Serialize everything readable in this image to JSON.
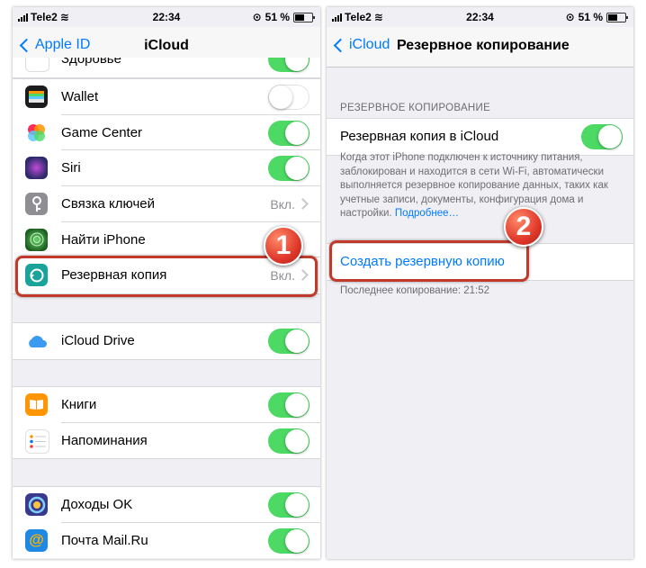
{
  "left": {
    "status": {
      "carrier": "Tele2",
      "time": "22:34",
      "battery": "51 %"
    },
    "nav": {
      "back": "Apple ID",
      "title": "iCloud"
    },
    "top_partial": {
      "label": "Здоровье"
    },
    "group1": [
      {
        "label": "Wallet",
        "icon": "wallet-icon",
        "icon_color": "#1c1c1e",
        "toggle": "off"
      },
      {
        "label": "Game Center",
        "icon": "game-center-icon",
        "icon_color": "#ffffff",
        "toggle": "on"
      },
      {
        "label": "Siri",
        "icon": "siri-icon",
        "icon_color": "#1e1e3c",
        "toggle": "on"
      },
      {
        "label": "Связка ключей",
        "icon": "key-icon",
        "icon_color": "#8e8e93",
        "value": "Вкл."
      },
      {
        "label": "Найти iPhone",
        "icon": "find-iphone-icon",
        "icon_color": "#2e7d32"
      },
      {
        "label": "Резервная копия",
        "icon": "backup-icon",
        "icon_color": "#1aa39b",
        "value": "Вкл."
      }
    ],
    "group2": [
      {
        "label": "iCloud Drive",
        "icon": "icloud-icon",
        "icon_color": "#ffffff",
        "toggle": "on"
      }
    ],
    "group3": [
      {
        "label": "Книги",
        "icon": "books-icon",
        "icon_color": "#ff9500",
        "toggle": "on"
      },
      {
        "label": "Напоминания",
        "icon": "reminders-icon",
        "icon_color": "#ffffff",
        "toggle": "on"
      }
    ],
    "group4": [
      {
        "label": "Доходы OK",
        "icon": "dohody-icon",
        "icon_color": "#3a3a8c",
        "toggle": "on"
      },
      {
        "label": "Почта Mail.Ru",
        "icon": "mailru-icon",
        "icon_color": "#1e88e5",
        "toggle": "on"
      }
    ],
    "badge": "1"
  },
  "right": {
    "status": {
      "carrier": "Tele2",
      "time": "22:34",
      "battery": "51 %"
    },
    "nav": {
      "back": "iCloud",
      "title": "Резервное копирование"
    },
    "section_header": "РЕЗЕРВНОЕ КОПИРОВАНИЕ",
    "backup_toggle_label": "Резервная копия в iCloud",
    "footnote": "Когда этот iPhone подключен к источнику питания, заблокирован и находится в сети Wi-Fi, автоматически выполняется резервное копирование данных, таких как учетные записи, документы, конфигурация дома и настройки.",
    "footnote_link": "Подробнее…",
    "create_backup": "Создать резервную копию",
    "last_backup": "Последнее копирование: 21:52",
    "badge": "2"
  },
  "colors": {
    "accent": "#007aff",
    "toggle_on": "#4cd964",
    "highlight": "#c0392b"
  }
}
